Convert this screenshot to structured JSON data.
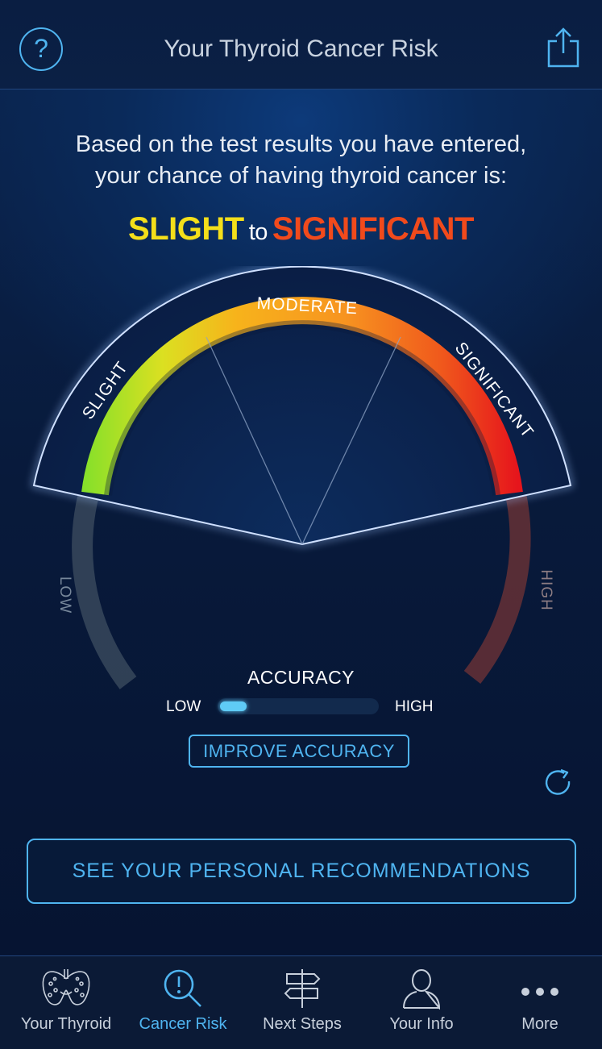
{
  "header": {
    "title": "Your Thyroid Cancer Risk",
    "help_icon": "question-circle-icon",
    "share_icon": "share-icon"
  },
  "result": {
    "intro_line1": "Based on the test results you have entered,",
    "intro_line2": "your chance of having thyroid cancer is:",
    "level_from": "SLIGHT",
    "connector": "to",
    "level_to": "SIGNIFICANT",
    "from_color": "#f4df1a",
    "to_color": "#f14a1c"
  },
  "gauge": {
    "segments": [
      "SLIGHT",
      "MODERATE",
      "SIGNIFICANT"
    ],
    "scale_low_label": "LOW",
    "scale_high_label": "HIGH",
    "highlighted_range": [
      "SLIGHT",
      "SIGNIFICANT"
    ]
  },
  "accuracy": {
    "title": "ACCURACY",
    "low_label": "LOW",
    "high_label": "HIGH",
    "level": 0.17,
    "improve_label": "IMPROVE ACCURACY"
  },
  "recommendations_label": "SEE YOUR PERSONAL RECOMMENDATIONS",
  "refresh_icon": "refresh-icon",
  "tabs": [
    {
      "label": "Your Thyroid",
      "icon": "thyroid-icon",
      "active": false
    },
    {
      "label": "Cancer Risk",
      "icon": "magnifier-alert-icon",
      "active": true
    },
    {
      "label": "Next Steps",
      "icon": "signpost-icon",
      "active": false
    },
    {
      "label": "Your Info",
      "icon": "person-icon",
      "active": false
    },
    {
      "label": "More",
      "icon": "more-dots-icon",
      "active": false
    }
  ],
  "colors": {
    "accent": "#4fb4f0",
    "background": "#071632"
  }
}
